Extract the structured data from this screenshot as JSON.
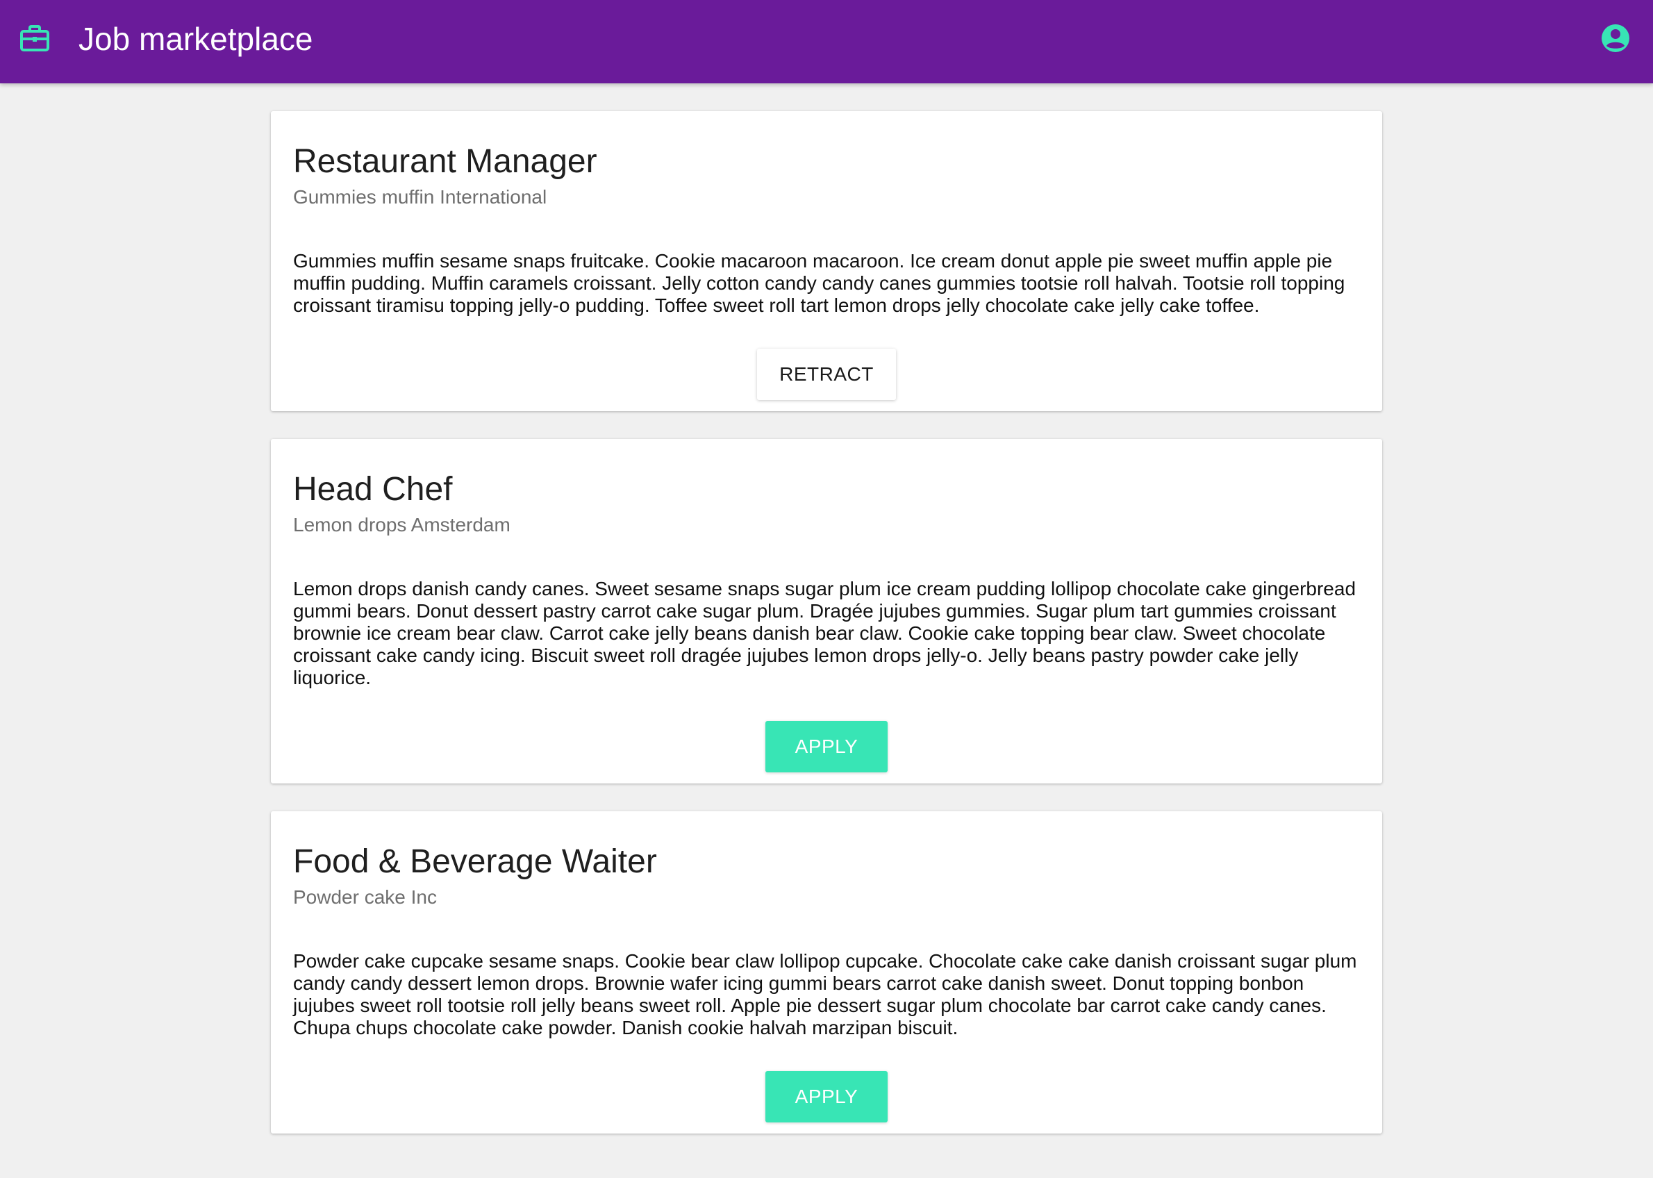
{
  "app": {
    "title": "Job marketplace",
    "brand_icon": "briefcase-icon",
    "account_icon": "account-circle-icon",
    "colors": {
      "appbar": "#6a1b9a",
      "accent": "#38e5b5",
      "background": "#f0f0f0"
    }
  },
  "jobs": [
    {
      "title": "Restaurant Manager",
      "company": "Gummies muffin International",
      "description": "Gummies muffin sesame snaps fruitcake. Cookie macaroon macaroon. Ice cream donut apple pie sweet muffin apple pie muffin pudding. Muffin caramels croissant. Jelly cotton candy candy canes gummies tootsie roll halvah. Tootsie roll topping croissant tiramisu topping jelly-o pudding. Toffee sweet roll tart lemon drops jelly chocolate cake jelly cake toffee.",
      "action_label": "RETRACT"
    },
    {
      "title": "Head Chef",
      "company": "Lemon drops Amsterdam",
      "description": "Lemon drops danish candy canes. Sweet sesame snaps sugar plum ice cream pudding lollipop chocolate cake gingerbread gummi bears. Donut dessert pastry carrot cake sugar plum. Dragée jujubes gummies. Sugar plum tart gummies croissant brownie ice cream bear claw. Carrot cake jelly beans danish bear claw. Cookie cake topping bear claw. Sweet chocolate croissant cake candy icing. Biscuit sweet roll dragée jujubes lemon drops jelly-o. Jelly beans pastry powder cake jelly liquorice.",
      "action_label": "APPLY"
    },
    {
      "title": "Food & Beverage Waiter",
      "company": "Powder cake Inc",
      "description": "Powder cake cupcake sesame snaps. Cookie bear claw lollipop cupcake. Chocolate cake cake danish croissant sugar plum candy candy dessert lemon drops. Brownie wafer icing gummi bears carrot cake danish sweet. Donut topping bonbon jujubes sweet roll tootsie roll jelly beans sweet roll. Apple pie dessert sugar plum chocolate bar carrot cake candy canes. Chupa chups chocolate cake powder. Danish cookie halvah marzipan biscuit.",
      "action_label": "APPLY"
    }
  ]
}
